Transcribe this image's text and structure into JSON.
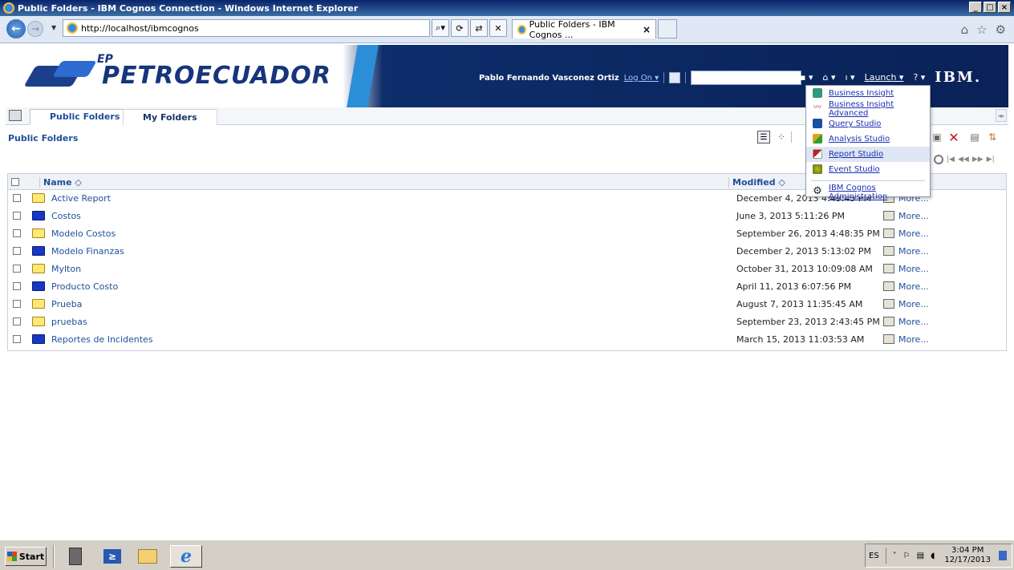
{
  "window": {
    "title": "Public Folders - IBM Cognos Connection - Windows Internet Explorer",
    "buttons": [
      "_",
      "□",
      "×"
    ]
  },
  "browser": {
    "address": "http://localhost/ibmcognos",
    "tab_title": "Public Folders - IBM Cognos ...",
    "tab_close": "×",
    "search_icon": "search-icon",
    "nav": {
      "back": "←",
      "forward": "→",
      "dropdown": "▼"
    },
    "tools": [
      "⌕▾",
      "⟳",
      "⇄",
      "✕"
    ],
    "right_icons": [
      "⌂",
      "☆",
      "⚙"
    ]
  },
  "banner": {
    "brand": "PETROECUADOR",
    "brand_prefix": "EP",
    "user_name": "Pablo Fernando Vasconez Ortiz",
    "log_on": "Log On ▾",
    "search_value": "",
    "launch": "Launch ▾",
    "help": "? ▾",
    "home": "⌂ ▾",
    "my_area": "ı ▾",
    "search_btn": "▪ ▾",
    "ibm": "IBM."
  },
  "tabs": {
    "active": "Public Folders",
    "inactive": "My Folders"
  },
  "section_title": "Public Folders",
  "table": {
    "col_name": "Name ◇",
    "col_modified": "Modified ◇",
    "more_label": "More...",
    "rows": [
      {
        "name": "Active Report",
        "modified": "December 4, 2013 4:49:45 PM",
        "folder": "yellow"
      },
      {
        "name": "Costos",
        "modified": "June 3, 2013 5:11:26 PM",
        "folder": "blue"
      },
      {
        "name": "Modelo Costos",
        "modified": "September 26, 2013 4:48:35 PM",
        "folder": "yellow"
      },
      {
        "name": "Modelo Finanzas",
        "modified": "December 2, 2013 5:13:02 PM",
        "folder": "blue"
      },
      {
        "name": "Mylton",
        "modified": "October 31, 2013 10:09:08 AM",
        "folder": "yellow"
      },
      {
        "name": "Producto Costo",
        "modified": "April 11, 2013 6:07:56 PM",
        "folder": "blue"
      },
      {
        "name": "Prueba",
        "modified": "August 7, 2013 11:35:45 AM",
        "folder": "yellow"
      },
      {
        "name": "pruebas",
        "modified": "September 23, 2013 2:43:45 PM",
        "folder": "yellow"
      },
      {
        "name": "Reportes de Incidentes",
        "modified": "March 15, 2013 11:03:53 AM",
        "folder": "blue"
      }
    ]
  },
  "launch_menu": {
    "items": [
      {
        "label": "Business Insight",
        "icon": "business-insight-icon"
      },
      {
        "label": "Business Insight Advanced",
        "icon": "business-insight-advanced-icon"
      },
      {
        "label": "Query Studio",
        "icon": "query-studio-icon"
      },
      {
        "label": "Analysis Studio",
        "icon": "analysis-studio-icon"
      },
      {
        "label": "Report Studio",
        "icon": "report-studio-icon"
      },
      {
        "label": "Event Studio",
        "icon": "event-studio-icon"
      },
      {
        "label": "IBM Cognos Administration",
        "icon": "administration-icon"
      }
    ],
    "hovered_index": 4
  },
  "taskbar": {
    "start": "Start",
    "lang": "ES",
    "time": "3:04 PM",
    "date": "12/17/2013",
    "tray_icons": [
      "˄",
      "⚐",
      "▤",
      "◖"
    ]
  },
  "pager": {
    "buttons": [
      "|◀",
      "◀◀",
      "▶▶",
      "▶|"
    ]
  }
}
